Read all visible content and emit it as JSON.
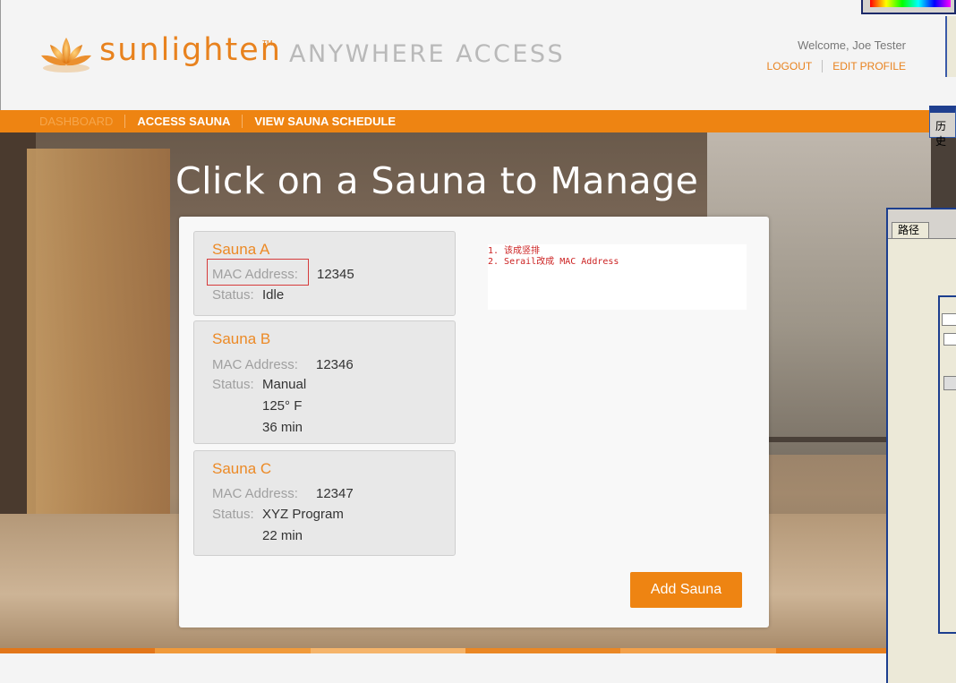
{
  "brand": {
    "name": "sunlighten",
    "tm": "TM",
    "product": "ANYWHERE ACCESS"
  },
  "header": {
    "welcome": "Welcome, Joe Tester",
    "logout": "LOGOUT",
    "edit_profile": "EDIT PROFILE"
  },
  "nav": {
    "items": [
      {
        "label": "DASHBOARD",
        "active": true
      },
      {
        "label": "ACCESS SAUNA",
        "active": false
      },
      {
        "label": "VIEW SAUNA SCHEDULE",
        "active": false
      }
    ]
  },
  "page_title": "Click on a Sauna to Manage",
  "saunas": [
    {
      "name": "Sauna A",
      "mac_label": "MAC Address:",
      "mac": "12345",
      "status_label": "Status:",
      "status": [
        "Idle"
      ]
    },
    {
      "name": "Sauna B",
      "mac_label": "MAC Address:",
      "mac": "12346",
      "status_label": "Status:",
      "status": [
        "Manual",
        "125° F",
        "36 min"
      ]
    },
    {
      "name": "Sauna C",
      "mac_label": "MAC Address:",
      "mac": "12347",
      "status_label": "Status:",
      "status": [
        "XYZ Program",
        "22 min"
      ]
    }
  ],
  "notes": [
    "1. 该成竖排",
    "2. Serail改成 MAC Address"
  ],
  "add_button": "Add Sauna",
  "overlay": {
    "tab_history": "历史",
    "tab_paths": "路径"
  },
  "colors": {
    "accent": "#ee8412",
    "brand_orange": "#e8821e",
    "note_red": "#cc2222"
  }
}
